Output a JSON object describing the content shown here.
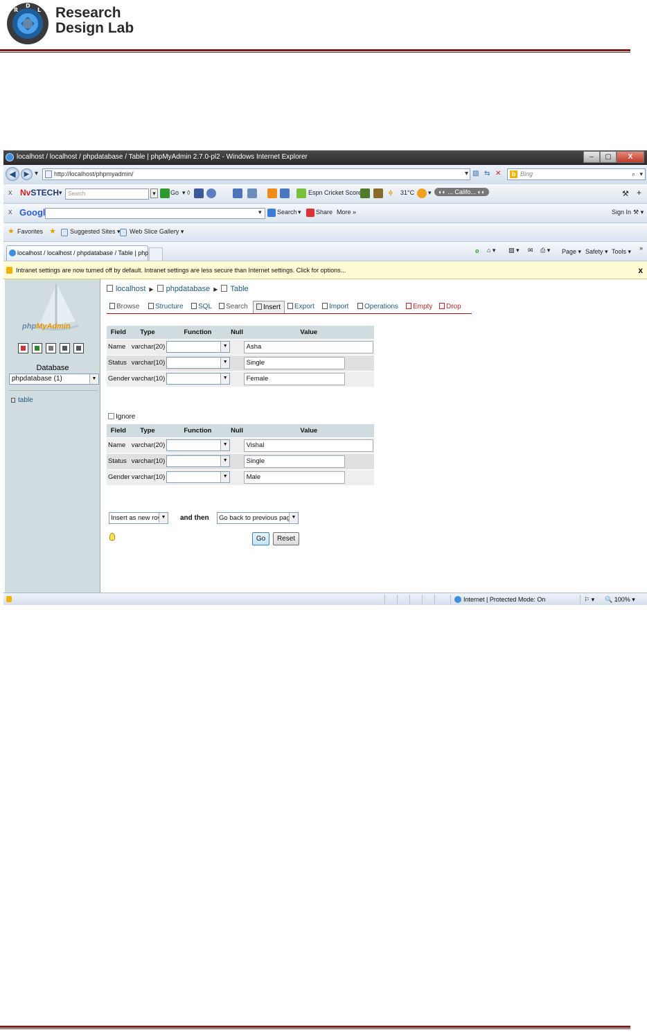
{
  "document": {
    "logo_letters": [
      "R",
      "D",
      "L"
    ],
    "logo_line1": "Research",
    "logo_line2": "Design Lab",
    "rule_color": "#7a1e1e"
  },
  "browser": {
    "window_title": "localhost / localhost / phpdatabase / Table | phpMyAdmin 2.7.0-pl2 - Windows Internet Explorer",
    "window_buttons": [
      "–",
      "▢",
      "X"
    ],
    "address": "http://localhost/phpmyadmin/",
    "bing_placeholder": "Bing",
    "toolbar_nvstech": {
      "close": "x",
      "brand_a": "Nv",
      "brand_b": "STECH",
      "search_placeholder": "Search",
      "go": "Go",
      "espn": "Espn Cricket Score",
      "temp": "31°C",
      "location": "... Califo..."
    },
    "toolbar_google": {
      "close": "x",
      "brand": "Google",
      "search": "Search",
      "share": "Share",
      "more": "More »",
      "sign_in": "Sign In"
    },
    "favorites_bar": {
      "favorites": "Favorites",
      "suggested": "Suggested Sites ▾",
      "webslice": "Web Slice Gallery ▾"
    },
    "tab_title": "localhost / localhost / phpdatabase / Table | php...",
    "command_bar": {
      "page": "Page ▾",
      "safety": "Safety ▾",
      "tools": "Tools ▾"
    },
    "infobar": "Intranet settings are now turned off by default. Intranet settings are less secure than Internet settings. Click for options...",
    "infobar_close": "x",
    "status": {
      "zone": "Internet | Protected Mode: On",
      "zoom": "100%"
    }
  },
  "pma": {
    "logo_text_a": "php",
    "logo_text_b": "MyAdmin",
    "sidebar_icons": [
      "home-icon",
      "query-icon",
      "sql-icon",
      "docs-icon",
      "docs2-icon"
    ],
    "database_label": "Database",
    "database_select": "phpdatabase (1)",
    "table_link": "table",
    "breadcrumb": {
      "server": "localhost",
      "database": "phpdatabase",
      "table": "Table"
    },
    "tabs": [
      {
        "label": "Browse"
      },
      {
        "label": "Structure"
      },
      {
        "label": "SQL"
      },
      {
        "label": "Search"
      },
      {
        "label": "Insert"
      },
      {
        "label": "Export"
      },
      {
        "label": "Import"
      },
      {
        "label": "Operations"
      },
      {
        "label": "Empty"
      },
      {
        "label": "Drop"
      }
    ],
    "columns": {
      "field": "Field",
      "type": "Type",
      "function": "Function",
      "null": "Null",
      "value": "Value"
    },
    "row1": [
      {
        "field": "Name",
        "type": "varchar(20)",
        "value": "Asha"
      },
      {
        "field": "Status",
        "type": "varchar(10)",
        "value": "Single"
      },
      {
        "field": "Gender",
        "type": "varchar(10)",
        "value": "Female"
      }
    ],
    "ignore_label": "Ignore",
    "row2": [
      {
        "field": "Name",
        "type": "varchar(20)",
        "value": "Vishal"
      },
      {
        "field": "Status",
        "type": "varchar(10)",
        "value": "Single"
      },
      {
        "field": "Gender",
        "type": "varchar(10)",
        "value": "Male"
      }
    ],
    "insert_mode": "Insert as new row",
    "and_then": "and then",
    "after_action": "Go back to previous page",
    "go_button": "Go",
    "reset_button": "Reset"
  }
}
